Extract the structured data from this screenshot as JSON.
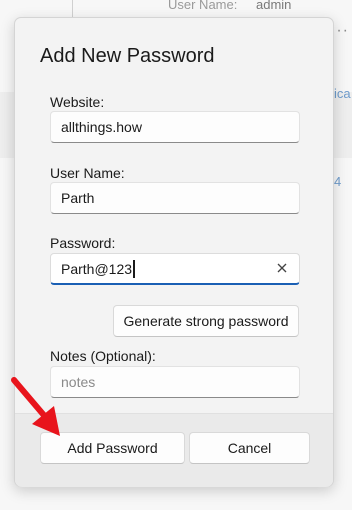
{
  "background": {
    "user_name_label": "User Name:",
    "user_name_value": "admin",
    "side_text_1": "ica",
    "side_text_2": "4"
  },
  "dialog": {
    "title": "Add New Password",
    "website": {
      "label": "Website:",
      "value": "allthings.how"
    },
    "user_name": {
      "label": "User Name:",
      "value": "Parth"
    },
    "password": {
      "label": "Password:",
      "value": "Parth@123"
    },
    "generate_button_label": "Generate strong password",
    "notes": {
      "label": "Notes (Optional):",
      "placeholder": "notes"
    },
    "add_button_label": "Add Password",
    "cancel_button_label": "Cancel"
  },
  "colors": {
    "accent": "#1a5fb4",
    "annotation_arrow": "#e8141c"
  },
  "icons": {
    "clear": "close-icon",
    "more": "more-icon",
    "annotation": "red-arrow-icon"
  }
}
